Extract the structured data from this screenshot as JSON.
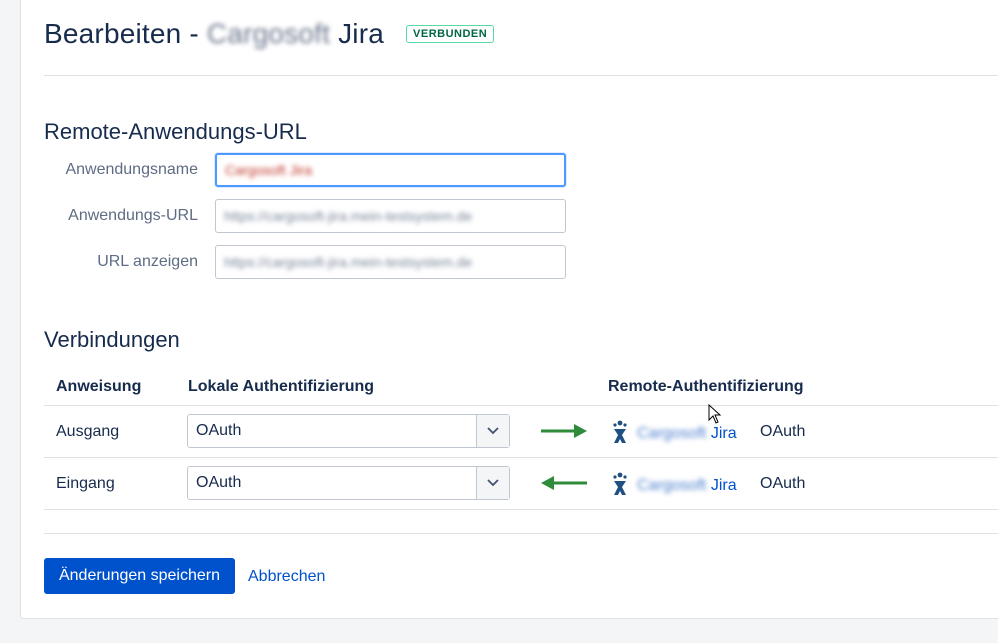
{
  "header": {
    "title_prefix": "Bearbeiten - ",
    "title_blurred": "Cargosoft",
    "title_suffix": " Jira",
    "status": "VERBUNDEN",
    "status_color": "#006644"
  },
  "remote_section": {
    "title": "Remote-Anwendungs-URL",
    "fields": [
      {
        "label": "Anwendungsname",
        "value": "Cargosoft Jira"
      },
      {
        "label": "Anwendungs-URL",
        "value": "https://cargosoft-jira.mein-testsystem.de"
      },
      {
        "label": "URL anzeigen",
        "value": "https://cargosoft-jira.mein-testsystem.de"
      }
    ]
  },
  "connections": {
    "title": "Verbindungen",
    "headers": {
      "direction": "Anweisung",
      "local": "Lokale Authentifizierung",
      "remote": "Remote-Authentifizierung"
    },
    "rows": [
      {
        "direction": "Ausgang",
        "local": "OAuth",
        "arrow": "right",
        "remote_name_blurred": "Cargosoft ",
        "remote_name_suffix": "Jira",
        "remote_auth": "OAuth"
      },
      {
        "direction": "Eingang",
        "local": "OAuth",
        "arrow": "left",
        "remote_name_blurred": "Cargosoft ",
        "remote_name_suffix": "Jira",
        "remote_auth": "OAuth"
      }
    ]
  },
  "actions": {
    "save": "Änderungen speichern",
    "cancel": "Abbrechen"
  },
  "colors": {
    "primary": "#0052cc",
    "arrow": "#2e8b3a",
    "focus": "#4c9aff"
  }
}
